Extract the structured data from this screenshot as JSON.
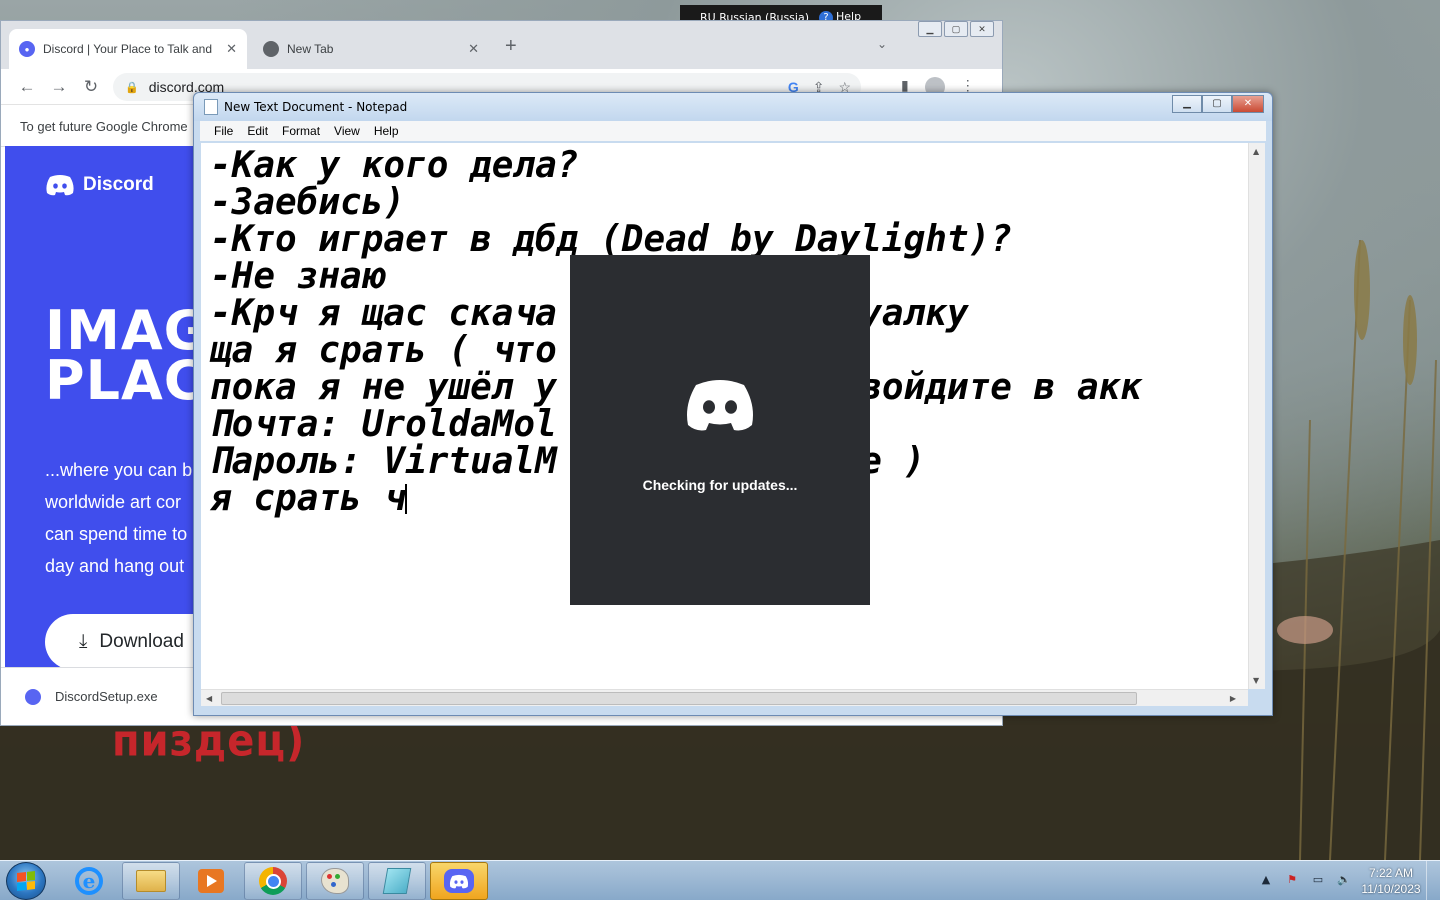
{
  "desktop": {
    "background_text": "пиздец)"
  },
  "language_bar": {
    "language": "RU Russian (Russia)",
    "help_label": "Help"
  },
  "chrome": {
    "tabs": [
      {
        "title": "Discord | Your Place to Talk and H",
        "active": true
      },
      {
        "title": "New Tab",
        "active": false
      }
    ],
    "url": "discord.com",
    "infobar_text": "To get future Google Chrome",
    "page": {
      "brand": "Discord",
      "hero_line1": "IMAG",
      "hero_line2": "PLAC",
      "subtitle_lines": [
        "...where you can b",
        "worldwide art cor",
        "can spend time to",
        "day and hang out"
      ],
      "download_label": "Download"
    },
    "download_file": "DiscordSetup.exe"
  },
  "notepad": {
    "title": "New Text Document - Notepad",
    "menu": [
      "File",
      "Edit",
      "Format",
      "View",
      "Help"
    ],
    "lines": [
      "-Как у кого дела?",
      "-Заебись)",
      "-Кто играет в дбд (Dead by Daylight)?",
      "-Не знаю",
      "-Крч я щас скача          виртуалку",
      "ща я срать ( что",
      "пока я не ушёл у          там войдите в акк",
      "Почта: UroldaMol",
      "Пароль: VirtualM          ерное )",
      "я срать ч"
    ]
  },
  "splash": {
    "status": "Checking for updates..."
  },
  "taskbar": {
    "time": "7:22 AM",
    "date": "11/10/2023"
  },
  "colors": {
    "discord_blurple": "#5865f2",
    "discord_page_bg": "#404eed",
    "splash_bg": "#2b2d31"
  }
}
